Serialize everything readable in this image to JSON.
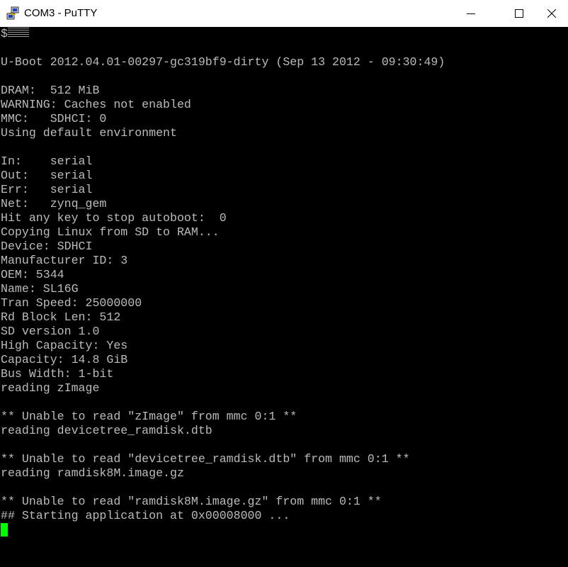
{
  "window": {
    "title": "COM3 - PuTTY",
    "icon": "putty-icon",
    "controls": {
      "minimize": "minimize-icon",
      "maximize": "maximize-icon",
      "close": "close-icon"
    }
  },
  "terminal": {
    "first_line_prefix": "$",
    "lines": [
      "",
      "",
      "U-Boot 2012.04.01-00297-gc319bf9-dirty (Sep 13 2012 - 09:30:49)",
      "",
      "DRAM:  512 MiB",
      "WARNING: Caches not enabled",
      "MMC:   SDHCI: 0",
      "Using default environment",
      "",
      "In:    serial",
      "Out:   serial",
      "Err:   serial",
      "Net:   zynq_gem",
      "Hit any key to stop autoboot:  0",
      "Copying Linux from SD to RAM...",
      "Device: SDHCI",
      "Manufacturer ID: 3",
      "OEM: 5344",
      "Name: SL16G",
      "Tran Speed: 25000000",
      "Rd Block Len: 512",
      "SD version 1.0",
      "High Capacity: Yes",
      "Capacity: 14.8 GiB",
      "Bus Width: 1-bit",
      "reading zImage",
      "",
      "** Unable to read \"zImage\" from mmc 0:1 **",
      "reading devicetree_ramdisk.dtb",
      "",
      "** Unable to read \"devicetree_ramdisk.dtb\" from mmc 0:1 **",
      "reading ramdisk8M.image.gz",
      "",
      "** Unable to read \"ramdisk8M.image.gz\" from mmc 0:1 **",
      "## Starting application at 0x00008000 ..."
    ],
    "cursor_line": 35,
    "colors": {
      "background": "#000000",
      "foreground": "#bbbbbb",
      "cursor": "#00ff00"
    }
  }
}
